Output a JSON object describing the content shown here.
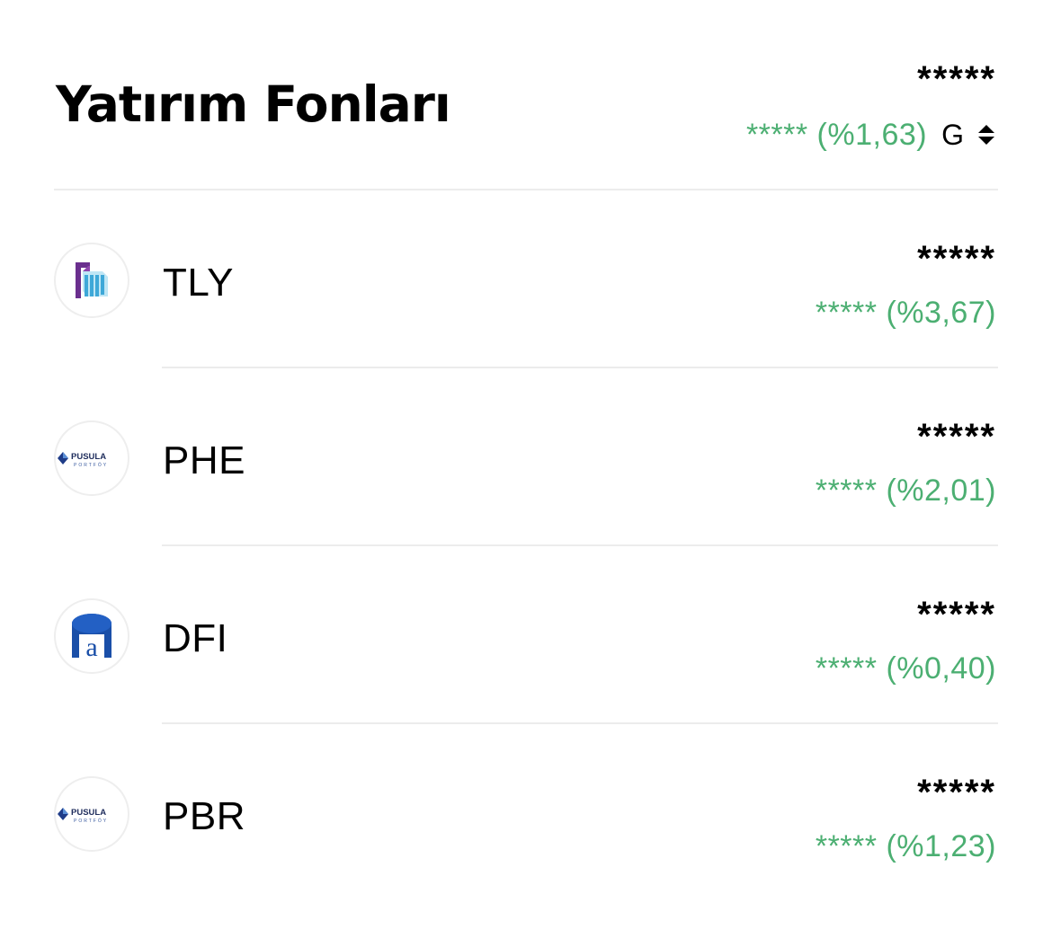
{
  "header": {
    "title": "Yatırım Fonları",
    "total_value": "*****",
    "total_change": "***** (%1,63)",
    "period_label": "G",
    "period_icon": "sort-updown-icon"
  },
  "colors": {
    "positive": "#4caf72",
    "text": "#000000",
    "divider": "#ececec"
  },
  "funds": [
    {
      "ticker": "TLY",
      "value": "*****",
      "change": "***** (%3,67)",
      "logo": "tera-logo"
    },
    {
      "ticker": "PHE",
      "value": "*****",
      "change": "***** (%2,01)",
      "logo": "pusula-portfoy-logo",
      "logo_text": "PUSULA",
      "logo_subtext": "PORTFÖY"
    },
    {
      "ticker": "DFI",
      "value": "*****",
      "change": "***** (%0,40)",
      "logo": "atlas-logo",
      "logo_text": "a"
    },
    {
      "ticker": "PBR",
      "value": "*****",
      "change": "***** (%1,23)",
      "logo": "pusula-portfoy-logo",
      "logo_text": "PUSULA",
      "logo_subtext": "PORTFÖY"
    }
  ]
}
